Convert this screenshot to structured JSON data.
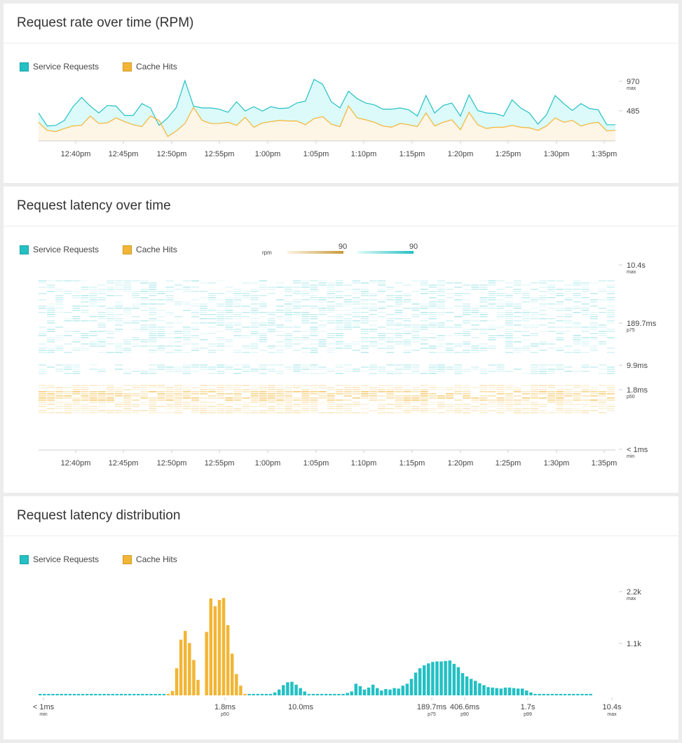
{
  "colors": {
    "service": "#23c0c4",
    "service_fill": "#dcfafa",
    "cache": "#f2b534",
    "cache_fill": "#fdf5e6",
    "axis": "#ccc",
    "label": "#444"
  },
  "legend": {
    "service_label": "Service Requests",
    "cache_label": "Cache Hits"
  },
  "panels": {
    "rate_title": "Request rate over time (RPM)",
    "latency_title": "Request latency over time",
    "dist_title": "Request latency distribution"
  },
  "heat_scale": {
    "unit": "rpm",
    "cache_max": "90",
    "service_max": "90"
  },
  "chart_data": [
    {
      "type": "area",
      "title": "Request rate over time (RPM)",
      "x_ticks": [
        "12:40pm",
        "12:45pm",
        "12:50pm",
        "12:55pm",
        "1:00pm",
        "1:05pm",
        "1:10pm",
        "1:15pm",
        "1:20pm",
        "1:25pm",
        "1:30pm",
        "1:35pm"
      ],
      "y_ticks": [
        {
          "value": "970",
          "sub": "max"
        },
        {
          "value": "485",
          "sub": ""
        }
      ],
      "ylim": [
        0,
        970
      ],
      "series": [
        {
          "name": "Service Requests",
          "values": [
            450,
            240,
            250,
            330,
            550,
            700,
            560,
            450,
            570,
            560,
            410,
            410,
            600,
            530,
            250,
            370,
            540,
            970,
            560,
            530,
            530,
            510,
            460,
            630,
            480,
            550,
            480,
            550,
            520,
            530,
            610,
            640,
            990,
            910,
            630,
            530,
            800,
            680,
            610,
            580,
            510,
            510,
            530,
            500,
            400,
            730,
            450,
            570,
            610,
            400,
            740,
            490,
            450,
            440,
            400,
            660,
            530,
            450,
            270,
            420,
            730,
            600,
            490,
            600,
            520,
            500,
            260,
            260
          ]
        },
        {
          "name": "Cache Hits",
          "values": [
            300,
            170,
            150,
            200,
            240,
            250,
            400,
            280,
            290,
            370,
            310,
            260,
            230,
            400,
            330,
            70,
            160,
            280,
            540,
            330,
            280,
            280,
            300,
            250,
            380,
            220,
            290,
            310,
            330,
            320,
            320,
            260,
            360,
            390,
            270,
            230,
            560,
            370,
            340,
            300,
            240,
            220,
            280,
            260,
            230,
            450,
            240,
            300,
            340,
            180,
            460,
            260,
            200,
            220,
            220,
            250,
            220,
            210,
            170,
            240,
            370,
            300,
            330,
            240,
            280,
            300,
            160,
            170
          ]
        }
      ]
    },
    {
      "type": "heatmap",
      "title": "Request latency over time",
      "x_ticks": [
        "12:40pm",
        "12:45pm",
        "12:50pm",
        "12:55pm",
        "1:00pm",
        "1:05pm",
        "1:10pm",
        "1:15pm",
        "1:20pm",
        "1:25pm",
        "1:30pm",
        "1:35pm"
      ],
      "y_ticks": [
        {
          "value": "10.4s",
          "sub": "max"
        },
        {
          "value": "189.7ms",
          "sub": "p75"
        },
        {
          "value": "9.9ms",
          "sub": ""
        },
        {
          "value": "1.8ms",
          "sub": "p50"
        },
        {
          "value": "< 1ms",
          "sub": "min"
        }
      ],
      "series": [
        {
          "name": "Service Requests",
          "band": [
            "9.9ms",
            "10.4s"
          ]
        },
        {
          "name": "Cache Hits",
          "band": [
            "< 1ms",
            "9.9ms"
          ]
        }
      ],
      "color_scale_max_rpm": 90
    },
    {
      "type": "bar",
      "title": "Request latency distribution",
      "x_ticks": [
        {
          "value": "< 1ms",
          "sub": "min"
        },
        {
          "value": "1.8ms",
          "sub": "p50"
        },
        {
          "value": "10.0ms",
          "sub": ""
        },
        {
          "value": "189.7ms",
          "sub": "p75"
        },
        {
          "value": "406.6ms",
          "sub": "p90"
        },
        {
          "value": "1.7s",
          "sub": "p99"
        },
        {
          "value": "10.4s",
          "sub": "max"
        }
      ],
      "y_ticks": [
        {
          "value": "2.2k",
          "sub": "max"
        },
        {
          "value": "1.1k",
          "sub": ""
        }
      ],
      "ylim": [
        0,
        2200
      ],
      "series": [
        {
          "name": "Cache Hits",
          "start_bin": 30,
          "values": [
            30,
            90,
            560,
            1150,
            1330,
            1080,
            730,
            320,
            0,
            1310,
            2000,
            1840,
            1970,
            2010,
            1450,
            860,
            440,
            200,
            30
          ]
        },
        {
          "name": "Service Requests",
          "start_bin": 0,
          "values": [
            30,
            30,
            30,
            30,
            30,
            30,
            30,
            30,
            30,
            30,
            30,
            30,
            30,
            30,
            30,
            30,
            30,
            30,
            30,
            30,
            30,
            30,
            30,
            30,
            30,
            30,
            30,
            30,
            30,
            30,
            0,
            0,
            0,
            0,
            0,
            0,
            0,
            0,
            0,
            0,
            0,
            0,
            0,
            0,
            0,
            0,
            0,
            0,
            0,
            30,
            30,
            30,
            30,
            30,
            30,
            60,
            120,
            210,
            270,
            280,
            220,
            150,
            80,
            30,
            30,
            30,
            30,
            30,
            30,
            30,
            30,
            30,
            50,
            80,
            240,
            190,
            120,
            160,
            220,
            150,
            100,
            130,
            120,
            150,
            140,
            200,
            240,
            340,
            470,
            560,
            620,
            660,
            690,
            700,
            700,
            710,
            720,
            650,
            580,
            460,
            390,
            340,
            300,
            250,
            210,
            170,
            160,
            150,
            140,
            160,
            160,
            150,
            140,
            140,
            100,
            60,
            30,
            30,
            30,
            30,
            30,
            30,
            30,
            30,
            30,
            30,
            30,
            30,
            30,
            30
          ]
        }
      ]
    }
  ]
}
